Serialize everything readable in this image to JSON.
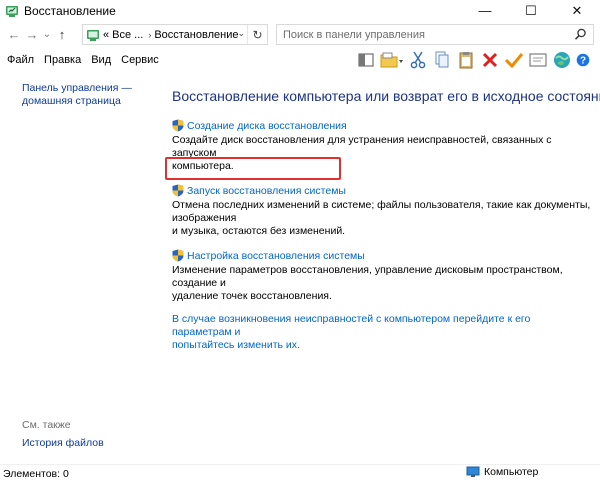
{
  "window": {
    "title": "Восстановление",
    "minimize": "—",
    "maximize": "☐",
    "close": "✕"
  },
  "nav": {
    "back": "←",
    "forward": "→",
    "recent": "⌄",
    "up": "↑"
  },
  "address": {
    "prefix": "«",
    "crumbs": [
      "Все ...",
      "Восстановление"
    ],
    "separator": "›",
    "dropdown": "⌄",
    "refresh": "↻"
  },
  "search": {
    "placeholder": "Поиск в панели управления"
  },
  "menu": [
    "Файл",
    "Правка",
    "Вид",
    "Сервис"
  ],
  "toolbar": {
    "icons": [
      "pane-icon",
      "folder-icon",
      "cut-icon",
      "copy-icon",
      "paste-icon",
      "delete-icon",
      "check-icon",
      "mail-icon",
      "globe-icon"
    ]
  },
  "sidebar": {
    "home_link_line1": "Панель управления —",
    "home_link_line2": "домашняя страница",
    "see_also": "См. также",
    "history_link": "История файлов"
  },
  "main": {
    "title": "Восстановление компьютера или возврат его в исходное состояние",
    "items": [
      {
        "link": "Создание диска восстановления",
        "desc_line1": "Создайте диск восстановления для устранения неисправностей, связанных с запуском",
        "desc_line2": "компьютера."
      },
      {
        "link": "Запуск восстановления системы",
        "desc_line1": "Отмена последних изменений в системе; файлы пользователя, такие как документы, изображения",
        "desc_line2": "и музыка, остаются без изменений."
      },
      {
        "link": "Настройка восстановления системы",
        "desc_line1": "Изменение параметров восстановления, управление дисковым пространством, создание и",
        "desc_line2": "удаление точек восстановления."
      }
    ],
    "help_line1": "В случае возникновения неисправностей с компьютером перейдите к его параметрам и",
    "help_line2": "попытайтесь изменить их."
  },
  "status": {
    "items_count": "Элементов: 0",
    "location": "Компьютер"
  },
  "colors": {
    "link": "#0066cc",
    "title": "#1e3287",
    "highlight": "#e03030"
  }
}
